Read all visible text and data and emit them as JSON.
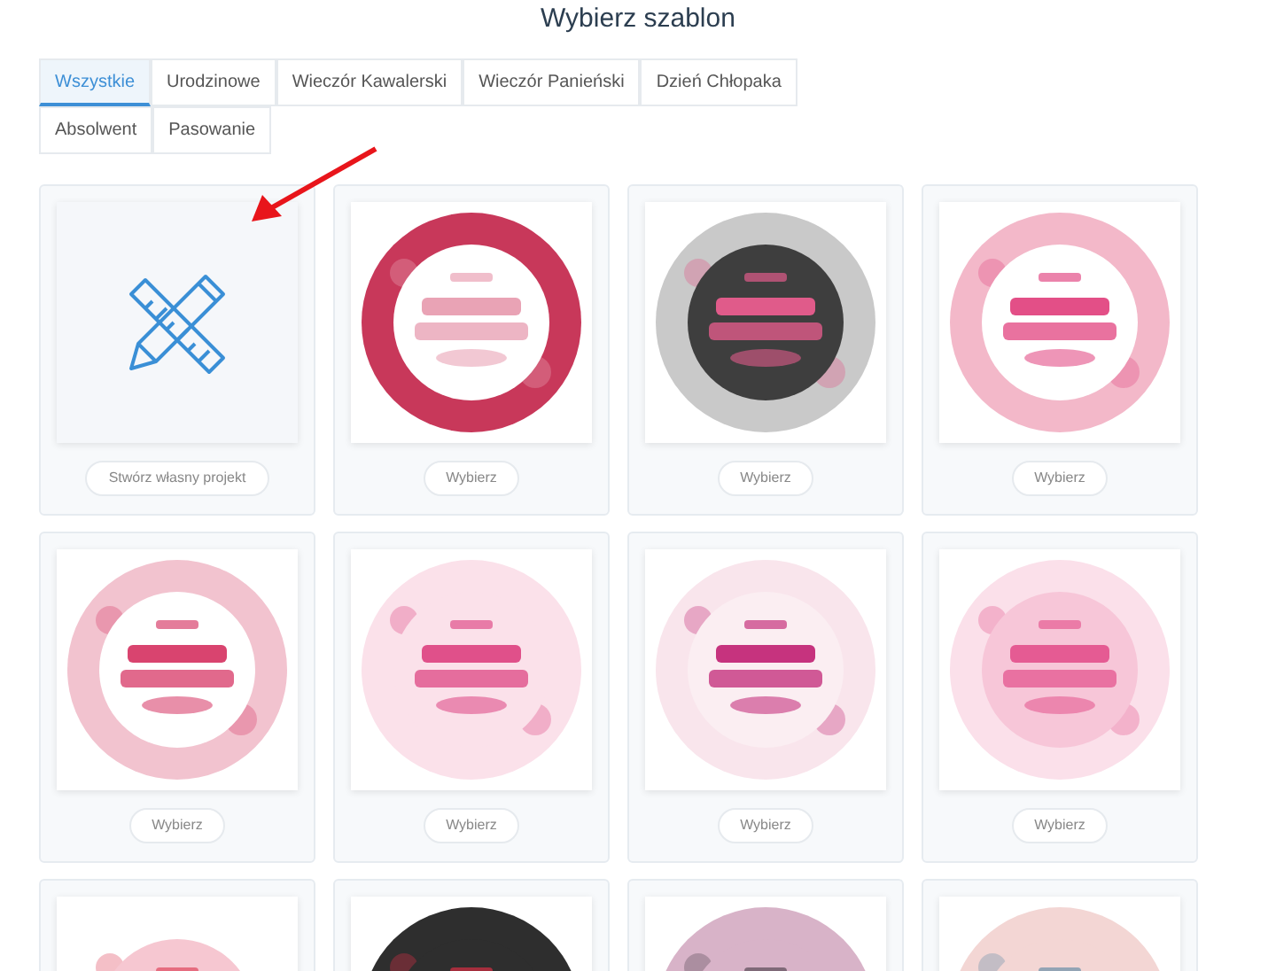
{
  "title": "Wybierz szablon",
  "tabs": [
    {
      "label": "Wszystkie",
      "selected": true
    },
    {
      "label": "Urodzinowe",
      "selected": false
    },
    {
      "label": "Wieczór Kawalerski",
      "selected": false
    },
    {
      "label": "Wieczór Panieński",
      "selected": false
    },
    {
      "label": "Dzień Chłopaka",
      "selected": false
    },
    {
      "label": "Absolwent",
      "selected": false
    },
    {
      "label": "Pasowanie",
      "selected": false
    }
  ],
  "cards": [
    {
      "kind": "custom",
      "button": "Stwórz własny projekt"
    },
    {
      "kind": "template",
      "button": "Wybierz"
    },
    {
      "kind": "template",
      "button": "Wybierz"
    },
    {
      "kind": "template",
      "button": "Wybierz"
    },
    {
      "kind": "template",
      "button": "Wybierz"
    },
    {
      "kind": "template",
      "button": "Wybierz"
    },
    {
      "kind": "template",
      "button": "Wybierz"
    },
    {
      "kind": "template",
      "button": "Wybierz"
    },
    {
      "kind": "template"
    },
    {
      "kind": "template"
    },
    {
      "kind": "template"
    },
    {
      "kind": "template"
    }
  ]
}
